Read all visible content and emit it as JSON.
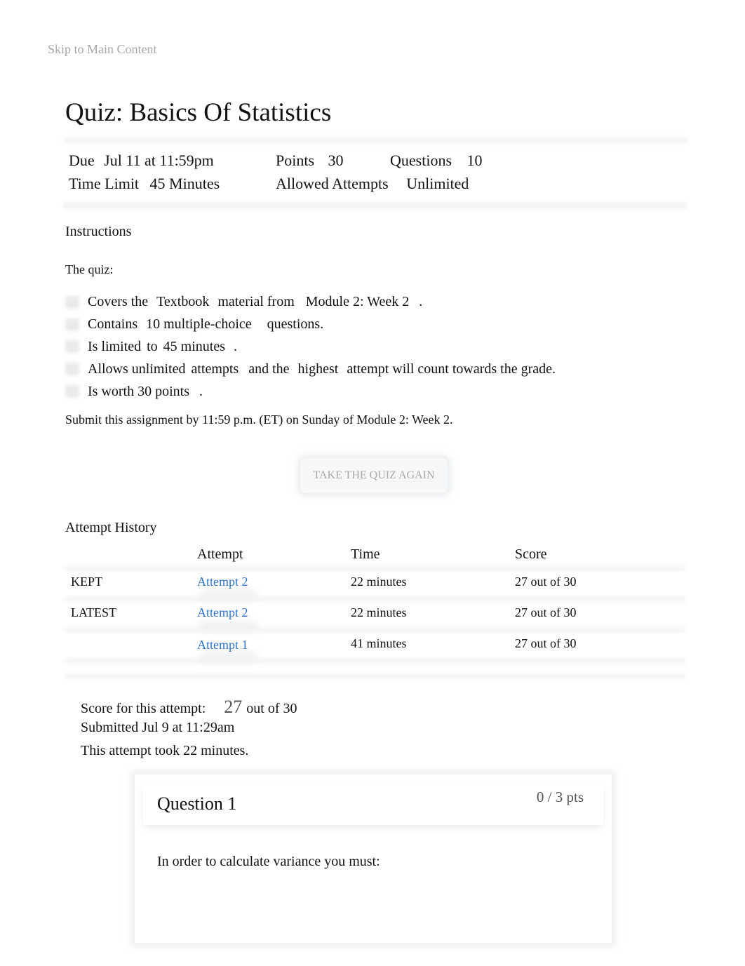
{
  "skip_link": "Skip to Main Content",
  "quiz": {
    "title": "Quiz: Basics Of Statistics",
    "meta": {
      "due_label": "Due",
      "due_value": "Jul 11 at 11:59pm",
      "points_label": "Points",
      "points_value": "30",
      "questions_label": "Questions",
      "questions_value": "10",
      "time_limit_label": "Time Limit",
      "time_limit_value": "45 Minutes",
      "allowed_attempts_label": "Allowed Attempts",
      "allowed_attempts_value": "Unlimited"
    }
  },
  "instructions": {
    "heading": "Instructions",
    "intro": "The quiz:",
    "items": [
      [
        "Covers the",
        "Textbook",
        "material from",
        "Module 2: Week 2",
        "."
      ],
      [
        "Contains",
        "10 multiple-choice",
        "questions."
      ],
      [
        "Is limited",
        "to",
        "45 minutes",
        "."
      ],
      [
        "Allows unlimited",
        "attempts",
        "and the",
        "highest",
        "attempt will count towards the grade."
      ],
      [
        "Is worth 30 points",
        "."
      ]
    ],
    "submit_note": "Submit this assignment by 11:59 p.m. (ET) on Sunday of Module 2: Week 2."
  },
  "retake_button": "TAKE THE QUIZ AGAIN",
  "attempt_history": {
    "heading": "Attempt History",
    "columns": [
      "",
      "Attempt",
      "Time",
      "Score"
    ],
    "rows": [
      {
        "tag": "KEPT",
        "attempt": "Attempt 2",
        "time": "22 minutes",
        "score": "27 out of 30"
      },
      {
        "tag": "LATEST",
        "attempt": "Attempt 2",
        "time": "22 minutes",
        "score": "27 out of 30"
      },
      {
        "tag": "",
        "attempt": "Attempt 1",
        "time": "41 minutes",
        "score": "27 out of 30"
      }
    ]
  },
  "score_summary": {
    "label": "Score for this attempt:",
    "score": "27",
    "out_of": "out of 30",
    "submitted": "Submitted Jul 9 at 11:29am",
    "duration": "This attempt took 22 minutes."
  },
  "question": {
    "title": "Question 1",
    "points": "0 / 3 pts",
    "text": "In order to calculate variance you must:"
  },
  "colors": {
    "link": "#2d74c9",
    "muted": "#a8a8a8",
    "points_text": "#555555"
  }
}
